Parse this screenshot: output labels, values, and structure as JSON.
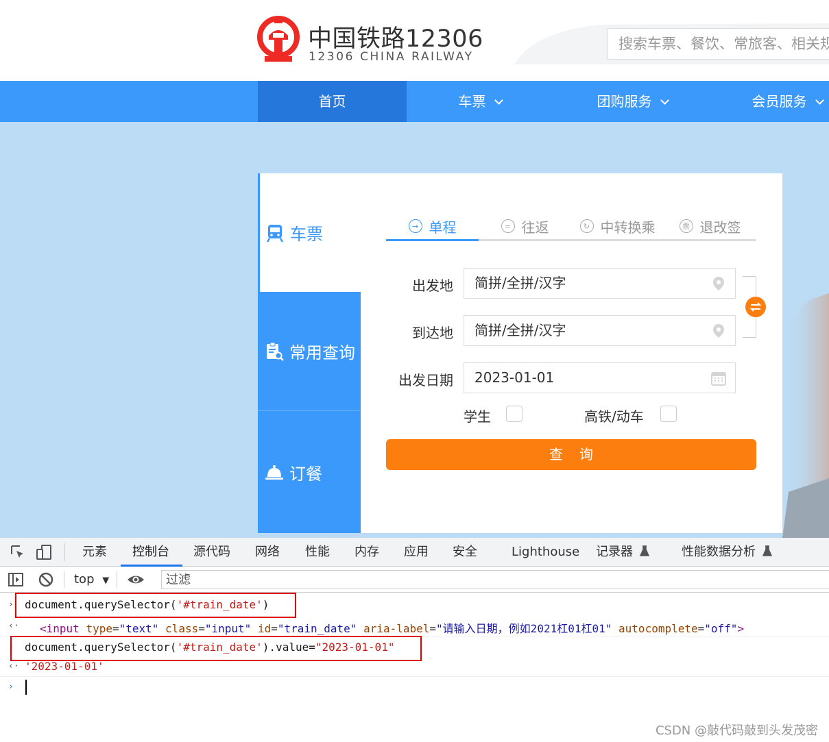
{
  "header": {
    "brand_title": "中国铁路12306",
    "brand_subtitle": "12306 CHINA RAILWAY",
    "search_placeholder": "搜索车票、餐饮、常旅客、相关规则"
  },
  "nav": {
    "items": [
      {
        "label": "首页",
        "active": true,
        "dropdown": false
      },
      {
        "label": "车票",
        "active": false,
        "dropdown": true
      },
      {
        "label": "团购服务",
        "active": false,
        "dropdown": true
      },
      {
        "label": "会员服务",
        "active": false,
        "dropdown": true
      }
    ]
  },
  "booking": {
    "side_tabs": [
      {
        "label": "车票",
        "icon": "train-icon",
        "active": true
      },
      {
        "label": "常用查询",
        "icon": "clipboard-search-icon",
        "active": false
      },
      {
        "label": "订餐",
        "icon": "food-cloche-icon",
        "active": false
      }
    ],
    "trip_tabs": [
      {
        "label": "单程",
        "icon": "arrow-right-circle-icon",
        "active": true
      },
      {
        "label": "往返",
        "icon": "equals-circle-icon",
        "active": false
      },
      {
        "label": "中转换乘",
        "icon": "cycle-circle-icon",
        "active": false
      },
      {
        "label": "退改签",
        "icon": "ticket-circle-icon",
        "active": false
      }
    ],
    "from_label": "出发地",
    "from_value": "简拼/全拼/汉字",
    "to_label": "到达地",
    "to_value": "简拼/全拼/汉字",
    "date_label": "出发日期",
    "date_value": "2023-01-01",
    "student_label": "学生",
    "student_checked": false,
    "highspeed_label": "高铁/动车",
    "highspeed_checked": false,
    "query_label": "查询"
  },
  "devtools": {
    "tabs": [
      {
        "label": "元素",
        "active": false
      },
      {
        "label": "控制台",
        "active": true
      },
      {
        "label": "源代码",
        "active": false
      },
      {
        "label": "网络",
        "active": false
      },
      {
        "label": "性能",
        "active": false
      },
      {
        "label": "内存",
        "active": false
      },
      {
        "label": "应用",
        "active": false
      },
      {
        "label": "安全",
        "active": false
      },
      {
        "label": "Lighthouse",
        "active": false
      },
      {
        "label": "记录器",
        "active": false
      },
      {
        "label": "性能数据分析",
        "active": false
      }
    ],
    "context": "top",
    "filter_placeholder": "过滤",
    "console": {
      "input1": {
        "prefix": "document.querySelector(",
        "arg": "'#train_date'",
        "suffix": ")"
      },
      "output1": {
        "open": "<input",
        "attrs": [
          {
            "name": "type",
            "value": "\"text\""
          },
          {
            "name": "class",
            "value": "\"input\""
          },
          {
            "name": "id",
            "value": "\"train_date\""
          },
          {
            "name": "aria-label",
            "value": "\"请输入日期，例如2021杠01杠01\""
          },
          {
            "name": "autocomplete",
            "value": "\"off\""
          }
        ],
        "close": ">"
      },
      "input2": {
        "prefix": "document.querySelector(",
        "arg": "'#train_date'",
        "mid": ").value=",
        "val": "\"2023-01-01\""
      },
      "output2": "'2023-01-01'"
    }
  },
  "watermark": "CSDN @敲代码敲到头发茂密",
  "colors": {
    "primary_blue": "#3b99fc",
    "nav_active": "#2677dc",
    "orange": "#fb7e0f",
    "logo_red": "#ee2a24",
    "highlight_red": "#e00000"
  }
}
